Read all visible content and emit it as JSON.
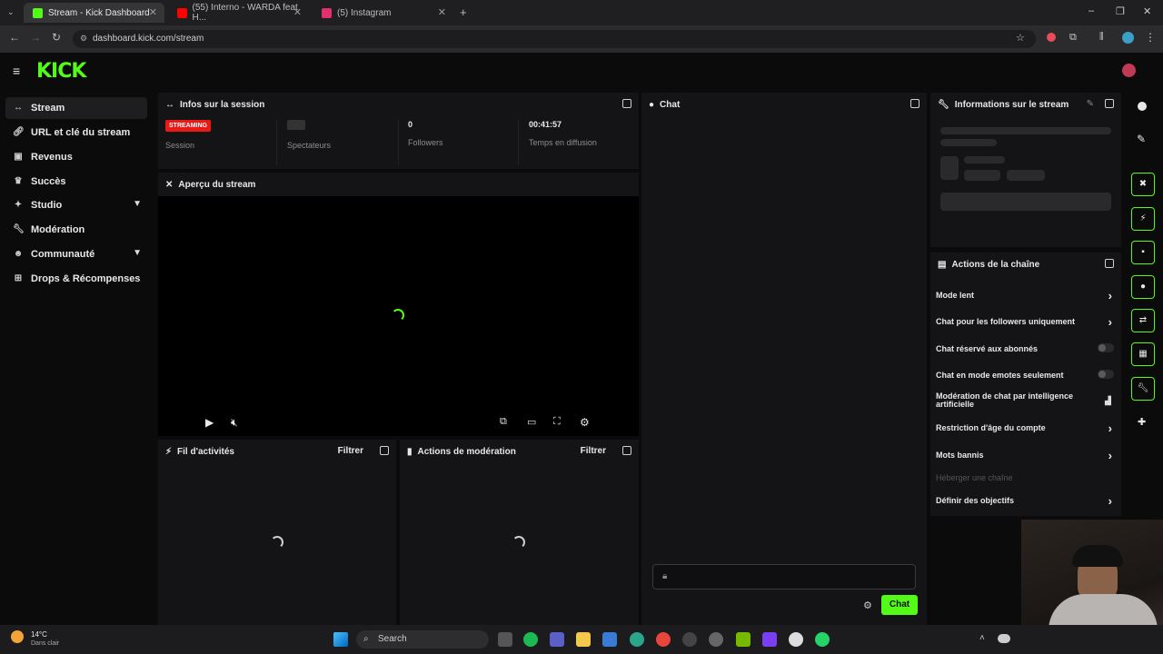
{
  "browser": {
    "tabs": [
      {
        "label": "Stream - Kick Dashboard",
        "color": "#53fc18"
      },
      {
        "label": "(55) Interno - WARDA feat H...",
        "color": "#ff0000"
      },
      {
        "label": "(5) Instagram",
        "color": "#e1306c"
      }
    ],
    "url": "dashboard.kick.com/stream"
  },
  "app": {
    "logo": "KICK"
  },
  "sidebar": {
    "items": [
      {
        "label": "Stream",
        "icon": "stream-icon"
      },
      {
        "label": "URL et clé du stream",
        "icon": "link-icon"
      },
      {
        "label": "Revenus",
        "icon": "revenue-icon"
      },
      {
        "label": "Succès",
        "icon": "trophy-icon"
      },
      {
        "label": "Studio",
        "icon": "studio-icon"
      },
      {
        "label": "Modération",
        "icon": "wrench-icon"
      },
      {
        "label": "Communauté",
        "icon": "community-icon"
      },
      {
        "label": "Drops & Récompenses",
        "icon": "gift-icon"
      }
    ]
  },
  "session": {
    "title": "Infos sur la session",
    "badge": "STREAMING",
    "session_label": "Session",
    "viewers_label": "Spectateurs",
    "followers_value": "0",
    "followers_label": "Followers",
    "time_value": "00:41:57",
    "time_label": "Temps en diffusion"
  },
  "preview": {
    "title": "Aperçu du stream"
  },
  "activity": {
    "title": "Fil d'activités",
    "filter": "Filtrer"
  },
  "modactions": {
    "title": "Actions de modération",
    "filter": "Filtrer"
  },
  "chat": {
    "title": "Chat",
    "send": "Chat"
  },
  "streaminfo": {
    "title": "Informations sur le stream"
  },
  "channel": {
    "title": "Actions de la chaîne",
    "items": [
      {
        "label": "Mode lent"
      },
      {
        "label": "Chat pour les followers uniquement"
      },
      {
        "label": "Chat réservé aux abonnés"
      },
      {
        "label": "Chat en mode emotes seulement"
      },
      {
        "label": "Modération de chat par intelligence artificielle"
      },
      {
        "label": "Restriction d'âge du compte"
      },
      {
        "label": "Mots bannis"
      },
      {
        "label": "Héberger une chaîne"
      },
      {
        "label": "Définir des objectifs"
      }
    ]
  },
  "taskbar": {
    "weather_temp": "14°C",
    "weather_desc": "Dans clair",
    "search": "Search"
  },
  "colors": {
    "accent": "#53fc18",
    "live": "#e91916"
  }
}
